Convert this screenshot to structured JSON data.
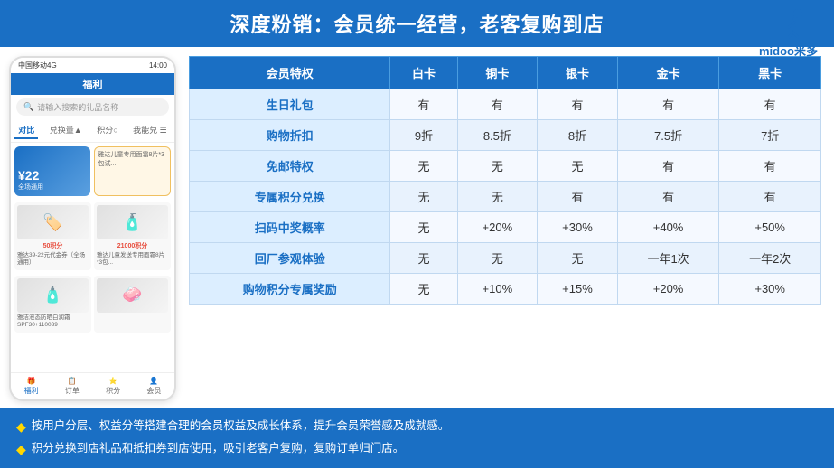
{
  "header": {
    "title": "深度粉销：会员统一经营，老客复购到店"
  },
  "logo": {
    "text": "midoo米多",
    "alt": "midoo logo"
  },
  "phone": {
    "status_bar": "中国移动4G",
    "time": "14:00",
    "nav_title": "福利",
    "search_placeholder": "请输入搜索的礼品名称",
    "tabs": [
      "对比",
      "兑换量▲",
      "积分○",
      "我能兑 ☰"
    ],
    "card_amount": "¥22",
    "card_label": "全场通用",
    "card2_label": "雅达儿童专用面霜8片*3包试...",
    "product1_points": "50积分",
    "product1_label": "雅达39-22元代金券（全场通用）",
    "product2_points": "21000积分",
    "product2_label": "雅达儿童发送专用面霜8片*3包...",
    "product3_desc": "雅洁液态防晒白润霜SPF30+110039",
    "bottom_nav": [
      "福利",
      "订单",
      "积分",
      "会员"
    ]
  },
  "table": {
    "headers": [
      "会员特权",
      "白卡",
      "铜卡",
      "银卡",
      "金卡",
      "黑卡"
    ],
    "rows": [
      [
        "生日礼包",
        "有",
        "有",
        "有",
        "有",
        "有"
      ],
      [
        "购物折扣",
        "9折",
        "8.5折",
        "8折",
        "7.5折",
        "7折"
      ],
      [
        "免邮特权",
        "无",
        "无",
        "无",
        "有",
        "有"
      ],
      [
        "专属积分兑换",
        "无",
        "无",
        "有",
        "有",
        "有"
      ],
      [
        "扫码中奖概率",
        "无",
        "+20%",
        "+30%",
        "+40%",
        "+50%"
      ],
      [
        "回厂参观体验",
        "无",
        "无",
        "无",
        "一年1次",
        "一年2次"
      ],
      [
        "购物积分专属奖励",
        "无",
        "+10%",
        "+15%",
        "+20%",
        "+30%"
      ]
    ]
  },
  "footer": {
    "items": [
      "按用户分层、权益分等搭建合理的会员权益及成长体系，提升会员荣誉感及成就感。",
      "积分兑换到店礼品和抵扣券到店使用，吸引老客户复购，复购订单归门店。"
    ]
  }
}
